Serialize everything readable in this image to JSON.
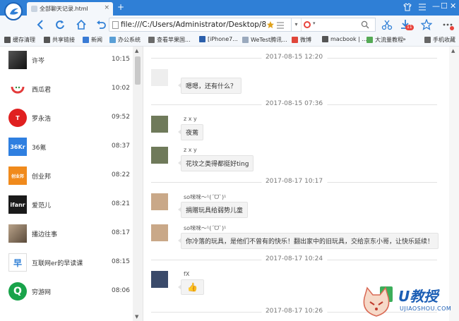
{
  "tab": {
    "title": "全部聊天记录.html",
    "close": "×",
    "new": "+"
  },
  "window_controls": {
    "minimize": "—",
    "maximize": "☐",
    "close": "✕"
  },
  "address": {
    "url": "file:///C:/Users/Administrator/Desktop/8"
  },
  "toolbar": {
    "badge": "11"
  },
  "bookmarks": [
    {
      "label": "缓存清理",
      "color": "#555555"
    },
    {
      "label": "共享链接",
      "color": "#555555"
    },
    {
      "label": "新闻",
      "color": "#3a7bd5"
    },
    {
      "label": "办公系统",
      "color": "#5a9fd6"
    },
    {
      "label": "查看苹果国...",
      "color": "#6a6a6a"
    },
    {
      "label": "[iPhone7...",
      "color": "#2b5fab"
    },
    {
      "label": "WeTest腾讯...",
      "color": "#9aa9bd"
    },
    {
      "label": "微博",
      "color": "#e0463a"
    },
    {
      "label": "macbook | ...",
      "color": "#555555"
    },
    {
      "label": "大流量教程",
      "color": "#55aa55"
    },
    {
      "label": "手机收藏",
      "color": "#666666"
    }
  ],
  "bookmarks_more": "»",
  "contacts": [
    {
      "name": "许岑",
      "time": "10:15",
      "color": "#3a3a3a",
      "mark": ""
    },
    {
      "name": "西瓜君",
      "time": "10:02",
      "color": "#ffffff",
      "mark": ""
    },
    {
      "name": "罗永浩",
      "time": "09:52",
      "color": "#e02020",
      "mark": "T"
    },
    {
      "name": "36氪",
      "time": "08:37",
      "color": "#2f7fe0",
      "mark": "36Kr"
    },
    {
      "name": "创业邦",
      "time": "08:22",
      "color": "#f08a1c",
      "mark": "创业邦"
    },
    {
      "name": "爱范儿",
      "time": "08:21",
      "color": "#1a1a1a",
      "mark": "ifanr"
    },
    {
      "name": "播边往事",
      "time": "08:17",
      "color": "#8a7766",
      "mark": ""
    },
    {
      "name": "互联网er的早读课",
      "time": "08:15",
      "color": "#ffffff",
      "mark": "早"
    },
    {
      "name": "穷游网",
      "time": "08:06",
      "color": "#19a34a",
      "mark": "Q"
    }
  ],
  "messages": [
    {
      "kind": "divider",
      "text": "2017-08-15 12:20"
    },
    {
      "kind": "msg",
      "sender": "",
      "text": "嗯嗯，还有什么？",
      "avatar": "#eeeeee"
    },
    {
      "kind": "divider",
      "text": "2017-08-15 07:36"
    },
    {
      "kind": "msg",
      "sender": "z x y",
      "text": "夜蔫",
      "avatar": "#6f7a5a"
    },
    {
      "kind": "msg",
      "sender": "z x y",
      "text": "花坟之类得都挺好ting",
      "avatar": "#6f7a5a"
    },
    {
      "kind": "divider",
      "text": "2017-08-17 10:17"
    },
    {
      "kind": "msg",
      "sender": "so咪咪～¹(ˊᗜˋ)¹",
      "text": "捐赠玩具给弱势儿童",
      "avatar": "#c9a888"
    },
    {
      "kind": "msg",
      "sender": "so咪咪～¹(ˊᗜˋ)¹",
      "text": "你冷落的玩具，是他们不曾有的快乐！翻出家中的旧玩具，交给京东小哥，让快乐延续！",
      "avatar": "#c9a888"
    },
    {
      "kind": "divider",
      "text": "2017-08-17 10:24"
    },
    {
      "kind": "msg",
      "sender": "fX",
      "text": "👍",
      "avatar": "#3a4a6a"
    },
    {
      "kind": "divider",
      "text": "2017-08-17 10:26"
    }
  ],
  "watermark": {
    "text": "U教授",
    "url": "UJIAOSHOU.COM"
  }
}
